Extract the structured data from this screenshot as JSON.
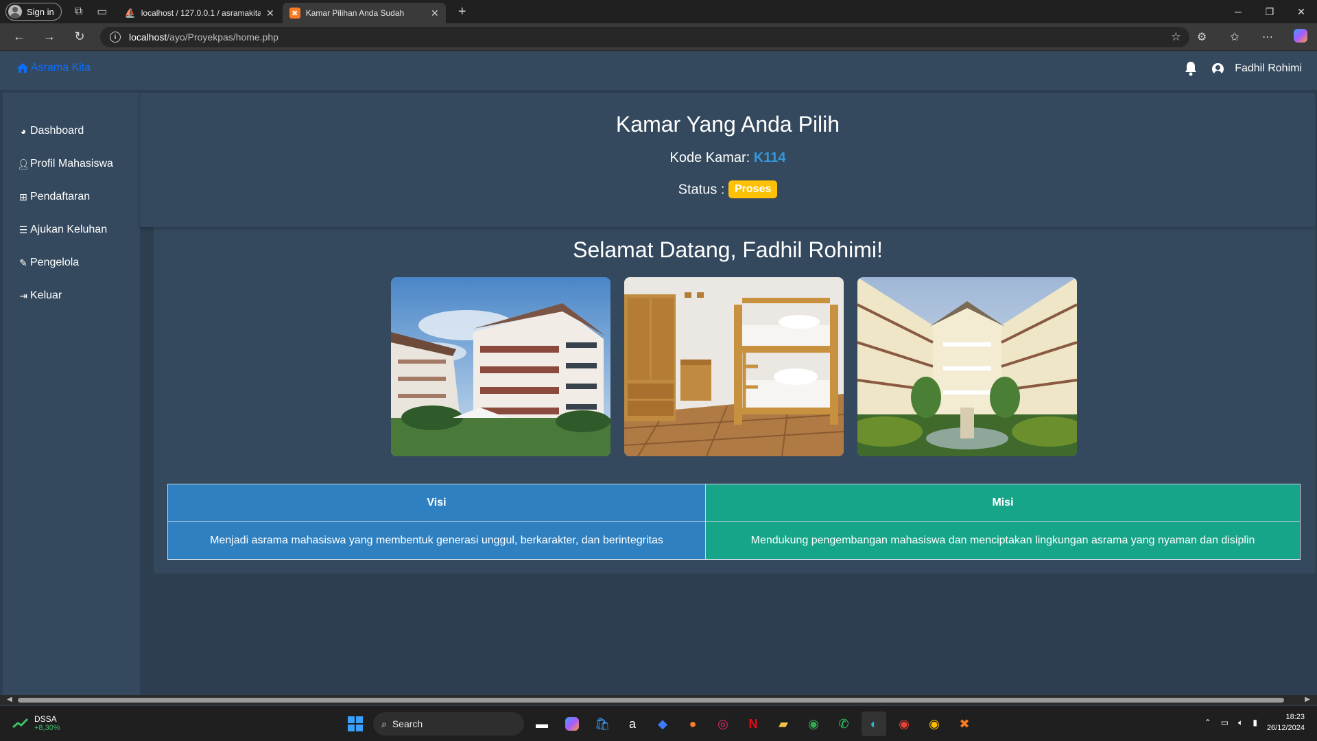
{
  "browser": {
    "signin_label": "Sign in",
    "tabs": [
      {
        "title": "localhost / 127.0.0.1 / asramakita",
        "active": false
      },
      {
        "title": "Kamar Pilihan Anda Sudah",
        "active": true
      }
    ],
    "url_host": "localhost",
    "url_path": "/ayo/Proyekpas/home.php"
  },
  "app": {
    "brand": "Asrama Kita",
    "user_name": "Fadhil Rohimi",
    "sidebar": {
      "items": [
        {
          "label": "Dashboard",
          "icon": "gauge-icon"
        },
        {
          "label": "Profil Mahasiswa",
          "icon": "user-icon"
        },
        {
          "label": "Pendaftaran",
          "icon": "table-icon"
        },
        {
          "label": "Ajukan Keluhan",
          "icon": "list-icon"
        },
        {
          "label": "Pengelola",
          "icon": "pencil-icon"
        },
        {
          "label": "Keluar",
          "icon": "sign-out-icon"
        }
      ]
    },
    "room": {
      "title": "Kamar Yang Anda Pilih",
      "kode_label": "Kode Kamar:",
      "kode_value": "K114",
      "status_label": "Status :",
      "status_value": "Proses"
    },
    "welcome": "Selamat Datang, Fadhil Rohimi!",
    "photos": [
      "dormitory-building-photo",
      "bunk-bed-room-photo",
      "courtyard-photo"
    ],
    "visi_misi": {
      "visi_header": "Visi",
      "misi_header": "Misi",
      "visi_text": "Menjadi asrama mahasiswa yang membentuk generasi unggul, berkarakter, dan berintegritas",
      "misi_text": "Mendukung pengembangan mahasiswa dan menciptakan lingkungan asrama yang nyaman dan disiplin"
    }
  },
  "taskbar": {
    "stock_name": "DSSA",
    "stock_change": "+8,30%",
    "search_label": "Search",
    "time": "18:23",
    "date": "26/12/2024"
  },
  "colors": {
    "brand": "#0d6efd",
    "badge": "#ffc107",
    "code": "#3498db",
    "visi": "#2f80c0",
    "misi": "#17a589",
    "panel": "#34495e"
  }
}
